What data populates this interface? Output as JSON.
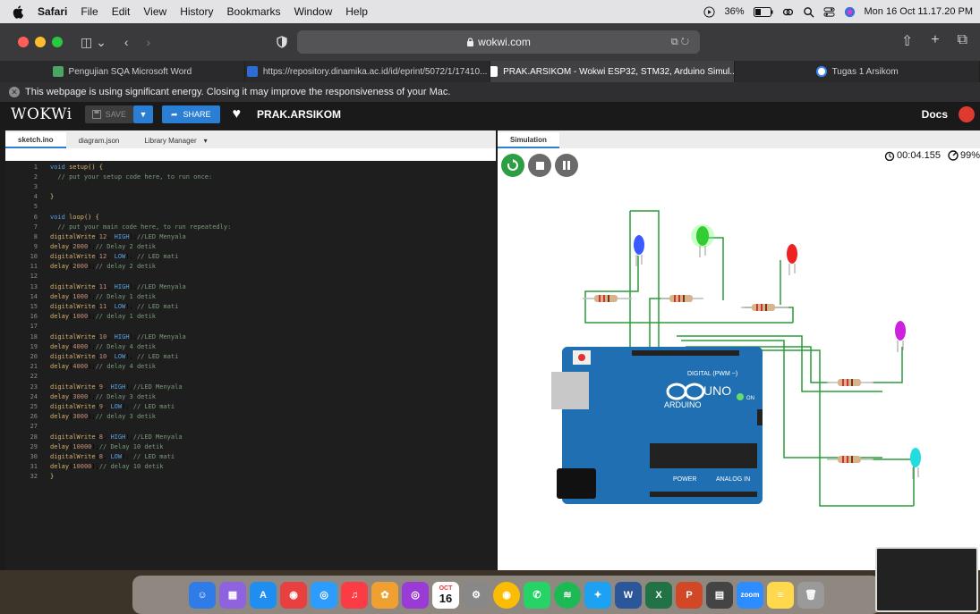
{
  "menubar": {
    "app": "Safari",
    "items": [
      "File",
      "Edit",
      "View",
      "History",
      "Bookmarks",
      "Window",
      "Help"
    ],
    "battery": "36%",
    "datetime": "Mon 16 Oct 11.17.20 PM"
  },
  "browser": {
    "url": "wokwi.com",
    "tabs": [
      {
        "label": "Pengujian SQA Microsoft Word"
      },
      {
        "label": "https://repository.dinamika.ac.id/id/eprint/5072/1/17410..."
      },
      {
        "label": "PRAK.ARSIKOM - Wokwi ESP32, STM32, Arduino Simul..."
      },
      {
        "label": "Tugas 1 Arsikom"
      }
    ],
    "notice": "This webpage is using significant energy. Closing it may improve the responsiveness of your Mac."
  },
  "wokwi": {
    "logo": "WOKWi",
    "save_label": "SAVE",
    "share_label": "SHARE",
    "project_name": "PRAK.ARSIKOM",
    "docs_label": "Docs"
  },
  "editor": {
    "tabs": [
      "sketch.ino",
      "diagram.json",
      "Library Manager"
    ]
  },
  "simulation": {
    "tab_label": "Simulation",
    "timer": "00:04.155",
    "speed": "99%",
    "board_label": "UNO",
    "board_brand": "ARDUINO",
    "digital_label": "DIGITAL (PWM ~)",
    "power_label": "POWER",
    "analog_label": "ANALOG IN",
    "on_label": "ON",
    "leds": [
      {
        "color": "#3a5bff",
        "name": "blue"
      },
      {
        "color": "#33cc33",
        "name": "green",
        "lit": true
      },
      {
        "color": "#ee2222",
        "name": "red"
      },
      {
        "color": "#cc22dd",
        "name": "purple"
      },
      {
        "color": "#22dddd",
        "name": "cyan"
      }
    ]
  },
  "dock": {
    "calendar_month": "OCT",
    "calendar_day": "16",
    "zoom_label": "zoom"
  }
}
